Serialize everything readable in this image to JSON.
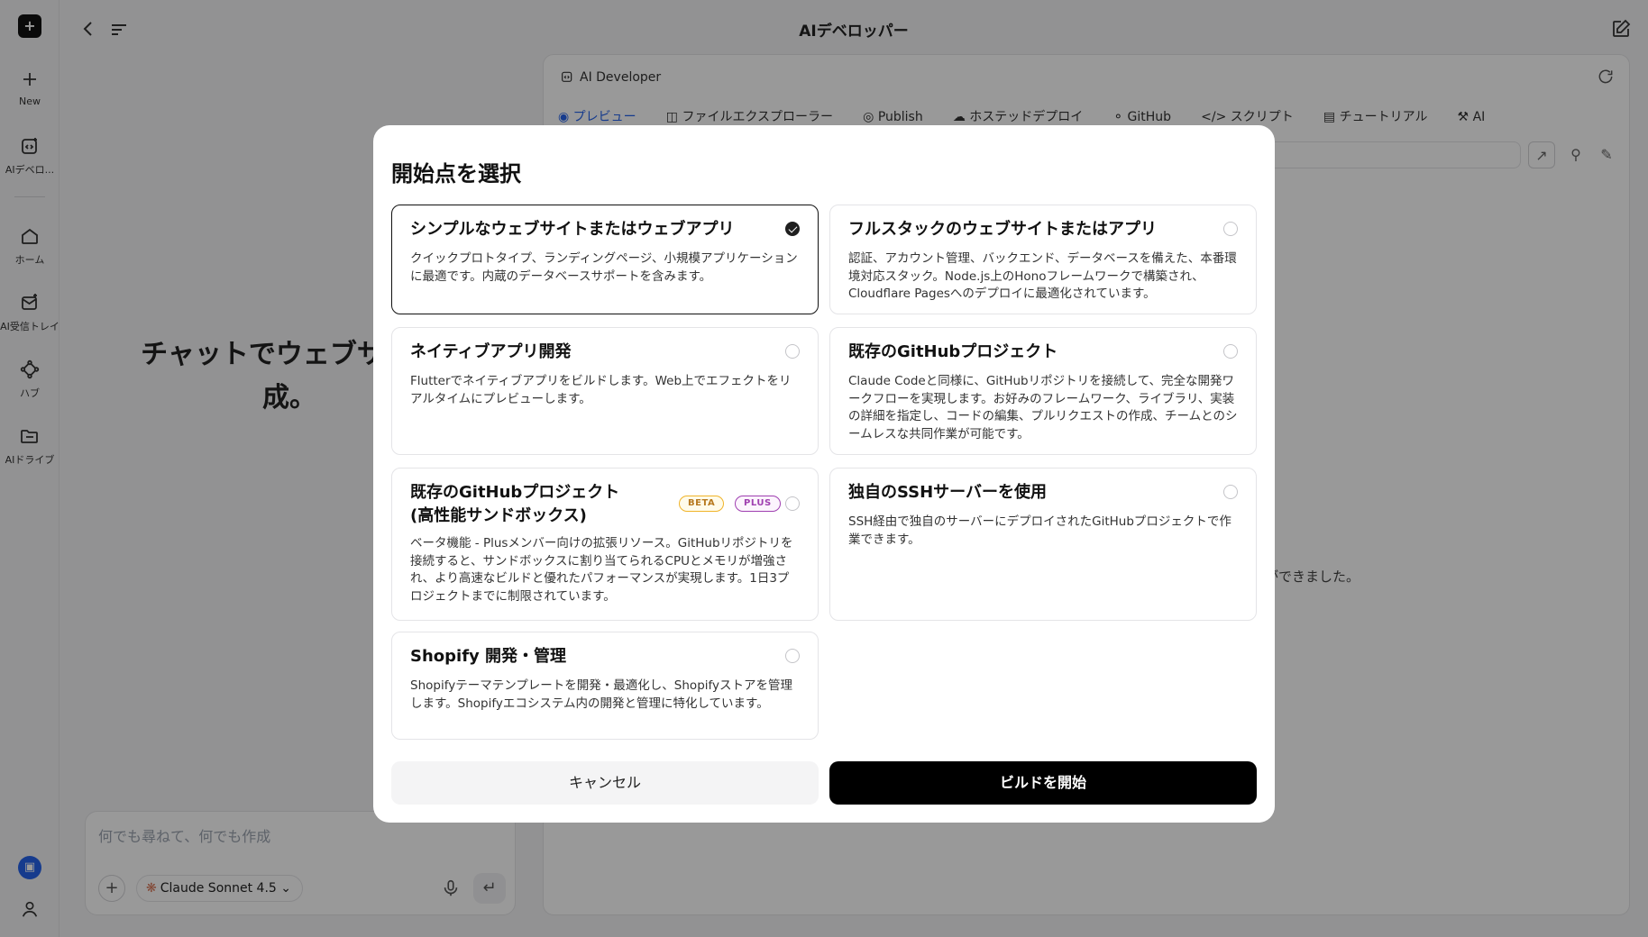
{
  "app": {
    "title": "AIデベロッパー"
  },
  "rail": {
    "items": [
      {
        "label": "New",
        "icon": "plus-icon"
      },
      {
        "label": "AIデベロ...",
        "icon": "ai-developer-icon"
      },
      {
        "label": "ホーム",
        "icon": "home-icon"
      },
      {
        "label": "AI受信トレイ",
        "icon": "inbox-icon"
      },
      {
        "label": "ハブ",
        "icon": "hub-icon"
      },
      {
        "label": "AIドライブ",
        "icon": "folder-icon"
      }
    ]
  },
  "chat": {
    "headline_line1": "チャットでウェブサイト",
    "headline_line2": "成。",
    "placeholder": "何でも尋ねて、何でも作成",
    "model_label": "Claude Sonnet 4.5"
  },
  "panel": {
    "title": "AI Developer",
    "tabs": [
      {
        "label": "プレビュー",
        "icon": "eye-icon"
      },
      {
        "label": "ファイルエクスプローラー",
        "icon": "folder-icon"
      },
      {
        "label": "Publish",
        "icon": "globe-icon"
      },
      {
        "label": "ホステッドデプロイ",
        "icon": "cloud-icon"
      },
      {
        "label": "GitHub",
        "icon": "github-icon"
      },
      {
        "label": "スクリプト",
        "icon": "code-icon"
      },
      {
        "label": "チュートリアル",
        "icon": "book-icon"
      },
      {
        "label": "AI",
        "icon": "wrench-icon"
      }
    ],
    "status_message": "ができました。"
  },
  "modal": {
    "title": "開始点を選択",
    "options": [
      {
        "title": "シンプルなウェブサイトまたはウェブアプリ",
        "description": "クイックプロトタイプ、ランディングページ、小規模アプリケーションに最適です。内蔵のデータベースサポートを含みます。",
        "selected": true
      },
      {
        "title": "フルスタックのウェブサイトまたはアプリ",
        "description": "認証、アカウント管理、バックエンド、データベースを備えた、本番環境対応スタック。Node.js上のHonoフレームワークで構築され、Cloudflare Pagesへのデプロイに最適化されています。",
        "selected": false
      },
      {
        "title": "ネイティブアプリ開発",
        "description": "Flutterでネイティブアプリをビルドします。Web上でエフェクトをリアルタイムにプレビューします。",
        "selected": false
      },
      {
        "title": "既存のGitHubプロジェクト",
        "description": "Claude Codeと同様に、GitHubリポジトリを接続して、完全な開発ワークフローを実現します。お好みのフレームワーク、ライブラリ、実装の詳細を指定し、コードの編集、プルリクエストの作成、チームとのシームレスな共同作業が可能です。",
        "selected": false
      },
      {
        "title": "既存のGitHubプロジェクト (高性能サンドボックス)",
        "description": "ベータ機能 - Plusメンバー向けの拡張リソース。GitHubリポジトリを接続すると、サンドボックスに割り当てられるCPUとメモリが増強され、より高速なビルドと優れたパフォーマンスが実現します。1日3プロジェクトまでに制限されています。",
        "badges": [
          "BETA",
          "PLUS"
        ],
        "selected": false
      },
      {
        "title": "独自のSSHサーバーを使用",
        "description": "SSH経由で独自のサーバーにデプロイされたGitHubプロジェクトで作業できます。",
        "selected": false
      },
      {
        "title": "Shopify 開発・管理",
        "description": "Shopifyテーマテンプレートを開発・最適化し、Shopifyストアを管理します。Shopifyエコシステム内の開発と管理に特化しています。",
        "selected": false
      }
    ],
    "cancel_label": "キャンセル",
    "start_label": "ビルドを開始"
  }
}
